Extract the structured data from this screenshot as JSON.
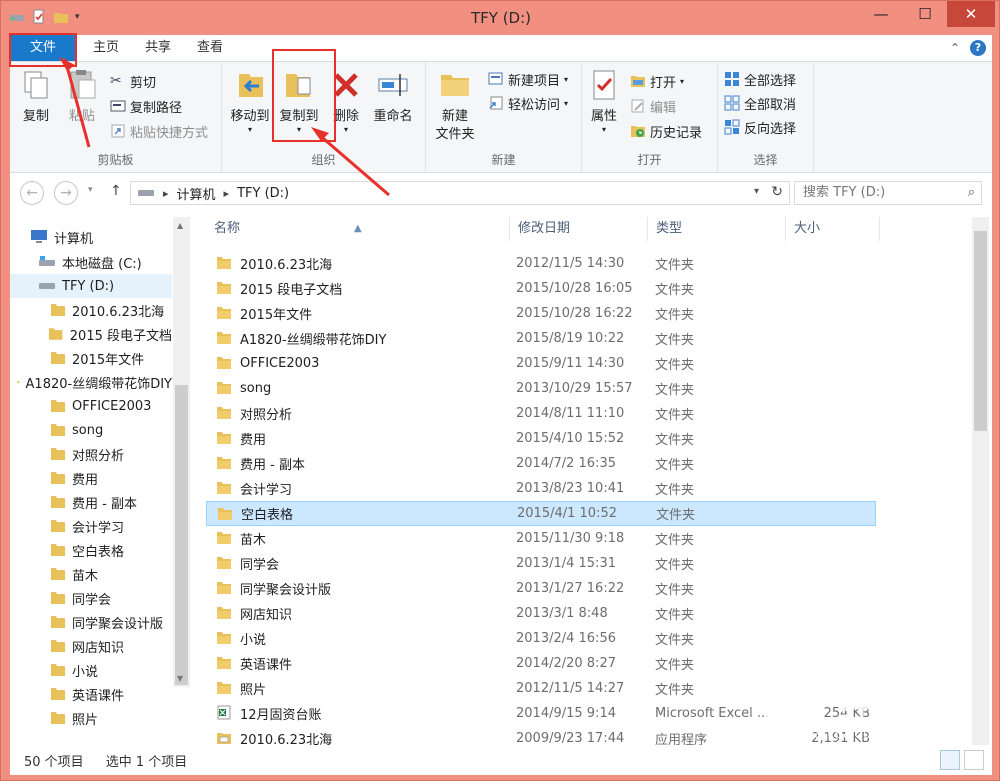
{
  "window": {
    "title": "TFY (D:)",
    "controls": [
      "—",
      "☐",
      "✕"
    ]
  },
  "tabs": [
    {
      "label": "文件"
    },
    {
      "label": "主页"
    },
    {
      "label": "共享"
    },
    {
      "label": "查看"
    }
  ],
  "ribbon": {
    "clipboard": {
      "label": "剪贴板",
      "copy": "复制",
      "paste": "粘贴",
      "cut": "剪切",
      "copy_path": "复制路径",
      "paste_shortcut": "粘贴快捷方式"
    },
    "organize": {
      "label": "组织",
      "move_to": "移动到",
      "copy_to": "复制到",
      "delete": "删除",
      "rename": "重命名"
    },
    "new": {
      "label": "新建",
      "new_folder_l1": "新建",
      "new_folder_l2": "文件夹",
      "new_item": "新建项目",
      "easy_access": "轻松访问"
    },
    "open": {
      "label": "打开",
      "properties": "属性",
      "open": "打开",
      "edit": "编辑",
      "history": "历史记录"
    },
    "select": {
      "label": "选择",
      "select_all": "全部选择",
      "select_none": "全部取消",
      "invert": "反向选择"
    }
  },
  "address": {
    "segments": [
      "计算机",
      "TFY (D:)"
    ],
    "search_placeholder": "搜索 TFY (D:)"
  },
  "nav": {
    "items": [
      {
        "label": "计算机",
        "level": 0,
        "kind": "computer"
      },
      {
        "label": "本地磁盘 (C:)",
        "level": 1,
        "kind": "drive-c"
      },
      {
        "label": "TFY (D:)",
        "level": 1,
        "kind": "drive",
        "selected": true
      },
      {
        "label": "2010.6.23北海",
        "level": 2,
        "kind": "folder"
      },
      {
        "label": "2015 段电子文档",
        "level": 2,
        "kind": "folder"
      },
      {
        "label": "2015年文件",
        "level": 2,
        "kind": "folder"
      },
      {
        "label": "A1820-丝绸缎带花饰DIY",
        "level": 2,
        "kind": "folder"
      },
      {
        "label": "OFFICE2003",
        "level": 2,
        "kind": "folder"
      },
      {
        "label": "song",
        "level": 2,
        "kind": "folder"
      },
      {
        "label": "对照分析",
        "level": 2,
        "kind": "folder"
      },
      {
        "label": "费用",
        "level": 2,
        "kind": "folder"
      },
      {
        "label": "费用 - 副本",
        "level": 2,
        "kind": "folder"
      },
      {
        "label": "会计学习",
        "level": 2,
        "kind": "folder"
      },
      {
        "label": "空白表格",
        "level": 2,
        "kind": "folder"
      },
      {
        "label": "苗木",
        "level": 2,
        "kind": "folder"
      },
      {
        "label": "同学会",
        "level": 2,
        "kind": "folder"
      },
      {
        "label": "同学聚会设计版",
        "level": 2,
        "kind": "folder"
      },
      {
        "label": "网店知识",
        "level": 2,
        "kind": "folder"
      },
      {
        "label": "小说",
        "level": 2,
        "kind": "folder"
      },
      {
        "label": "英语课件",
        "level": 2,
        "kind": "folder"
      },
      {
        "label": "照片",
        "level": 2,
        "kind": "folder"
      }
    ]
  },
  "columns": [
    "名称",
    "修改日期",
    "类型",
    "大小"
  ],
  "files": [
    {
      "name": "2010.6.23北海",
      "date": "2012/11/5 14:30",
      "type": "文件夹",
      "size": "",
      "kind": "folder"
    },
    {
      "name": "2015 段电子文档",
      "date": "2015/10/28 16:05",
      "type": "文件夹",
      "size": "",
      "kind": "folder"
    },
    {
      "name": "2015年文件",
      "date": "2015/10/28 16:22",
      "type": "文件夹",
      "size": "",
      "kind": "folder"
    },
    {
      "name": "A1820-丝绸缎带花饰DIY",
      "date": "2015/8/19 10:22",
      "type": "文件夹",
      "size": "",
      "kind": "folder"
    },
    {
      "name": "OFFICE2003",
      "date": "2015/9/11 14:30",
      "type": "文件夹",
      "size": "",
      "kind": "folder"
    },
    {
      "name": "song",
      "date": "2013/10/29 15:57",
      "type": "文件夹",
      "size": "",
      "kind": "folder"
    },
    {
      "name": "对照分析",
      "date": "2014/8/11 11:10",
      "type": "文件夹",
      "size": "",
      "kind": "folder"
    },
    {
      "name": "费用",
      "date": "2015/4/10 15:52",
      "type": "文件夹",
      "size": "",
      "kind": "folder"
    },
    {
      "name": "费用 - 副本",
      "date": "2014/7/2 16:35",
      "type": "文件夹",
      "size": "",
      "kind": "folder"
    },
    {
      "name": "会计学习",
      "date": "2013/8/23 10:41",
      "type": "文件夹",
      "size": "",
      "kind": "folder"
    },
    {
      "name": "空白表格",
      "date": "2015/4/1 10:52",
      "type": "文件夹",
      "size": "",
      "kind": "folder",
      "selected": true
    },
    {
      "name": "苗木",
      "date": "2015/11/30 9:18",
      "type": "文件夹",
      "size": "",
      "kind": "folder"
    },
    {
      "name": "同学会",
      "date": "2013/1/4 15:31",
      "type": "文件夹",
      "size": "",
      "kind": "folder"
    },
    {
      "name": "同学聚会设计版",
      "date": "2013/1/27 16:22",
      "type": "文件夹",
      "size": "",
      "kind": "folder"
    },
    {
      "name": "网店知识",
      "date": "2013/3/1 8:48",
      "type": "文件夹",
      "size": "",
      "kind": "folder"
    },
    {
      "name": "小说",
      "date": "2013/2/4 16:56",
      "type": "文件夹",
      "size": "",
      "kind": "folder"
    },
    {
      "name": "英语课件",
      "date": "2014/2/20 8:27",
      "type": "文件夹",
      "size": "",
      "kind": "folder"
    },
    {
      "name": "照片",
      "date": "2012/11/5 14:27",
      "type": "文件夹",
      "size": "",
      "kind": "folder"
    },
    {
      "name": "12月固资台账",
      "date": "2014/9/15 9:14",
      "type": "Microsoft Excel ...",
      "size": "254 KB",
      "kind": "excel"
    },
    {
      "name": "2010.6.23北海",
      "date": "2009/9/23 17:44",
      "type": "应用程序",
      "size": "2,191 KB",
      "kind": "app"
    }
  ],
  "status": {
    "count": "50 个项目",
    "selected": "选中 1 个项目"
  },
  "watermark": {
    "main": "Bai 经验",
    "sub": "jingyan.baidu.com"
  },
  "colors": {
    "accent": "#1979ca",
    "annotation": "#e8302a",
    "folder": "#e8c15a",
    "selection": "#cce8ff"
  }
}
